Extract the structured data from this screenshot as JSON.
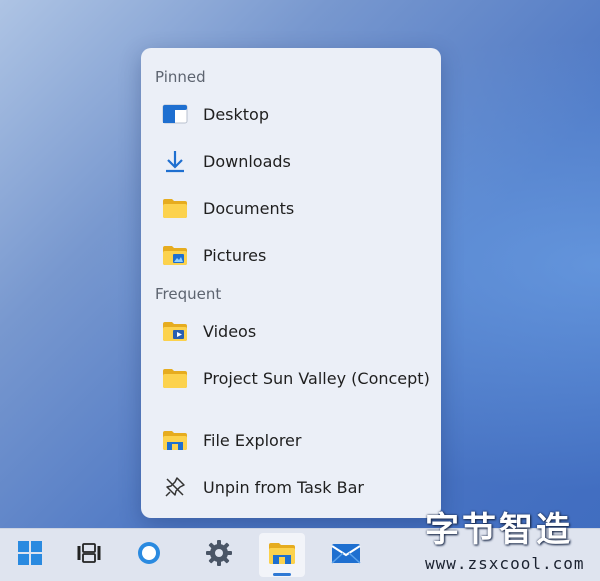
{
  "jumplist": {
    "sections": {
      "pinned": "Pinned",
      "frequent": "Frequent"
    },
    "pinned_items": [
      {
        "label": "Desktop",
        "icon": "desktop-icon"
      },
      {
        "label": "Downloads",
        "icon": "download-arrow-icon"
      },
      {
        "label": "Documents",
        "icon": "folder-icon"
      },
      {
        "label": "Pictures",
        "icon": "pictures-folder-icon"
      }
    ],
    "frequent_items": [
      {
        "label": "Videos",
        "icon": "videos-folder-icon"
      },
      {
        "label": "Project Sun Valley (Concept)",
        "icon": "folder-icon"
      }
    ],
    "actions": [
      {
        "label": "File Explorer",
        "icon": "file-explorer-icon"
      },
      {
        "label": "Unpin from Task Bar",
        "icon": "unpin-icon"
      }
    ]
  },
  "taskbar": {
    "buttons": [
      {
        "name": "start",
        "icon": "windows-logo-icon"
      },
      {
        "name": "task-view",
        "icon": "task-view-icon"
      },
      {
        "name": "search",
        "icon": "search-circle-icon"
      },
      {
        "name": "settings",
        "icon": "gear-icon"
      },
      {
        "name": "file-explorer",
        "icon": "file-explorer-icon",
        "active": true
      },
      {
        "name": "mail",
        "icon": "mail-icon"
      }
    ]
  },
  "watermark": {
    "chinese_text": "字节智造",
    "url": "www.zsxcool.com"
  },
  "colors": {
    "accent": "#2f79d4",
    "folder_yellow": "#f4c542",
    "panel_bg": "#ebeff7",
    "taskbar_bg": "#dfe4ef"
  }
}
